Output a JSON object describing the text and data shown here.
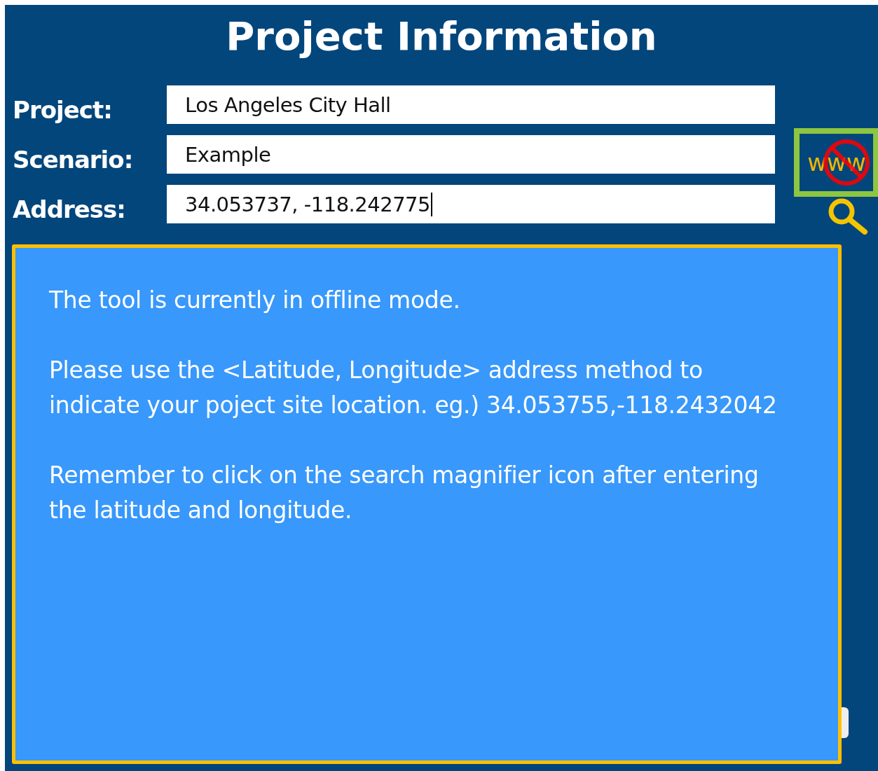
{
  "window": {
    "title": "Project Information"
  },
  "fields": [
    {
      "label": "Project:",
      "value": "Los Angeles City Hall",
      "focused": false
    },
    {
      "label": "Scenario:",
      "value": "Example",
      "focused": false
    },
    {
      "label": "Address:",
      "value": "34.053737, -118.242775",
      "focused": true
    }
  ],
  "offline_button": {
    "text": "www"
  },
  "message": {
    "paragraphs": [
      "The tool is currently in offline mode.",
      "Please use the <Latitude, Longitude> address method to indicate your poject site location. eg.) 34.053755,-118.2432042",
      "Remember to click on the search magnifier icon after entering the latitude and longitude."
    ]
  }
}
